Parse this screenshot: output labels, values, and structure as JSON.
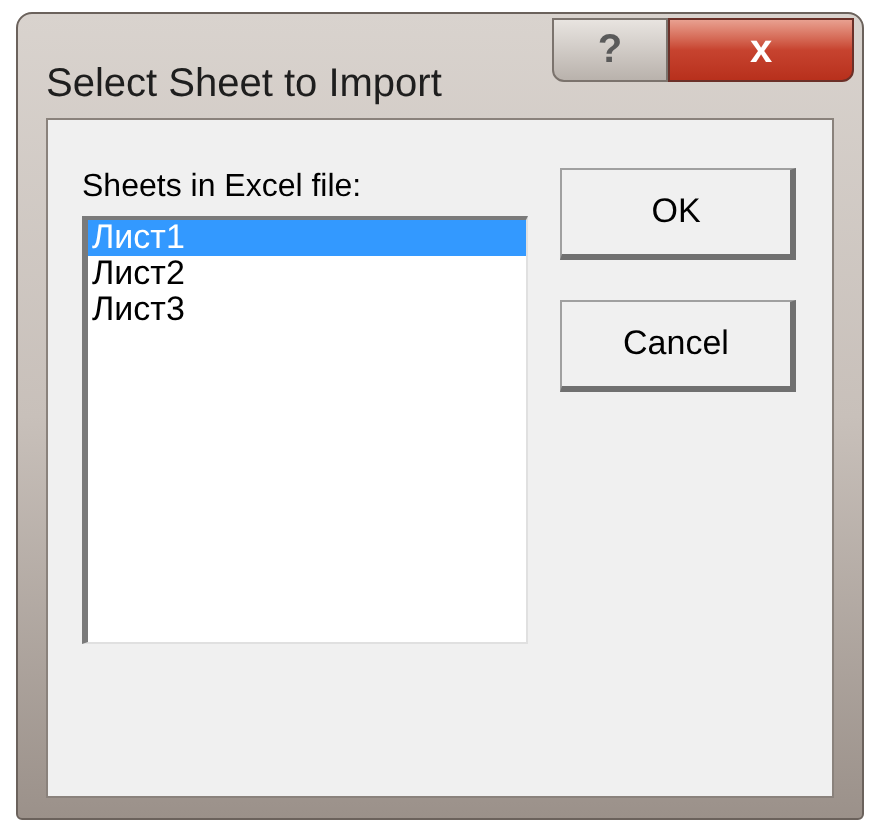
{
  "window": {
    "title": "Select Sheet to Import",
    "help_button": "?",
    "close_button": "x"
  },
  "list": {
    "label": "Sheets in Excel file:",
    "items": [
      {
        "label": "Лист1",
        "selected": true
      },
      {
        "label": "Лист2",
        "selected": false
      },
      {
        "label": "Лист3",
        "selected": false
      }
    ]
  },
  "buttons": [
    "OK",
    "Cancel"
  ]
}
